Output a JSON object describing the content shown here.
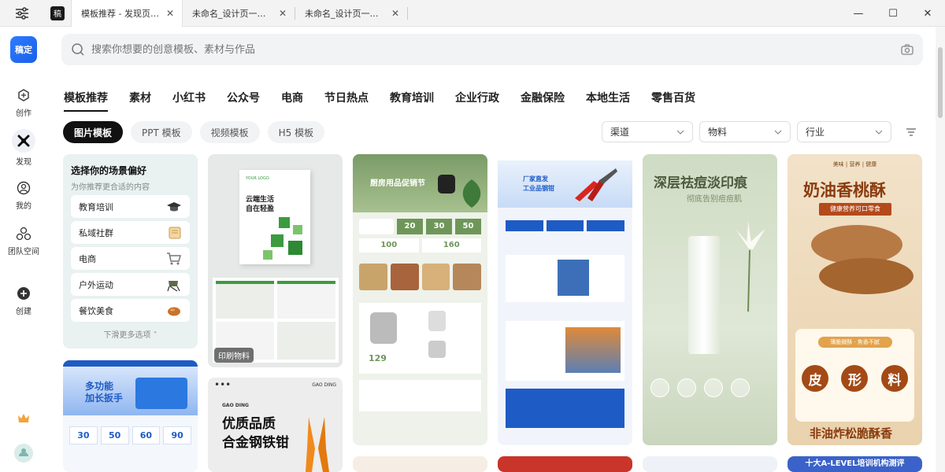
{
  "titlebar": {
    "logo_text": "稿",
    "tabs": [
      {
        "label": "模板推荐 - 发现页 - 稿定设计",
        "active": true
      },
      {
        "label": "未命名_设计页一稿定",
        "active": false
      },
      {
        "label": "未命名_设计页一稿定",
        "active": false
      }
    ],
    "close_glyph": "✕",
    "controls": {
      "minimize": "—",
      "maximize": "☐",
      "close": "✕"
    }
  },
  "sidebar": {
    "brand": "稿定",
    "items": [
      {
        "label": "创作",
        "icon": "create-icon"
      },
      {
        "label": "发现",
        "icon": "discover-icon",
        "active": true
      },
      {
        "label": "我的",
        "icon": "user-icon"
      },
      {
        "label": "团队空间",
        "icon": "team-icon"
      },
      {
        "label": "创建",
        "icon": "plus-icon"
      }
    ]
  },
  "search": {
    "placeholder": "搜索你想要的创意模板、素材与作品"
  },
  "categories": [
    "模板推荐",
    "素材",
    "小红书",
    "公众号",
    "电商",
    "节日热点",
    "教育培训",
    "企业行政",
    "金融保险",
    "本地生活",
    "零售百货"
  ],
  "types": [
    "图片模板",
    "PPT 模板",
    "视频模板",
    "H5 模板"
  ],
  "filters": {
    "channel": "渠道",
    "material": "物料",
    "industry": "行业"
  },
  "preferences": {
    "title": "选择你的场景偏好",
    "subtitle": "为你推荐更合适的内容",
    "items": [
      "教育培训",
      "私域社群",
      "电商",
      "户外运动",
      "餐饮美食"
    ],
    "more": "下滑更多选项"
  },
  "cards": {
    "print": {
      "tag": "印刷物料",
      "cover1": "云端生活",
      "cover2": "自在轻盈",
      "logo": "YOUR LOGO"
    },
    "tool_red": {
      "title": "厂家直发",
      "subtitle": "工业品钢钳"
    },
    "kitchen": {
      "title": "厨房用品促销节",
      "prices": [
        "20",
        "30",
        "50",
        "100",
        "160"
      ],
      "price2": "129"
    },
    "skincare": {
      "title": "深层祛痘淡印痕",
      "subtitle": "彻底告别痘痘肌"
    },
    "cookie": {
      "title": "奶油香桃酥",
      "subtitle": "健康营养可口零食",
      "tags": [
        "皮",
        "形",
        "料"
      ],
      "bottom": "非油炸松脆酥香",
      "top_line": "美味 | 营养 | 健康",
      "sub2": "薄脆微酥 · 焦香不腻"
    },
    "wrench": {
      "title": "多功能",
      "title2": "加长扳手",
      "prices": [
        "30",
        "50",
        "60",
        "90"
      ]
    },
    "plier": {
      "brand": "GAO DING",
      "title": "优质品质",
      "title2": "合金钢铁钳"
    },
    "edu": {
      "title": "十大A-LEVEL培训机构测评"
    }
  }
}
